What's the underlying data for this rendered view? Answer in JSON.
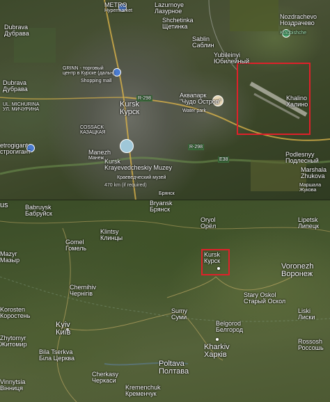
{
  "top": {
    "places": [
      {
        "name": "metro",
        "l1": "METRO",
        "l2": "Hypermarket"
      },
      {
        "name": "lazurnoye",
        "l1": "Lazurnoye",
        "l2": "Лазурное"
      },
      {
        "name": "dubrava",
        "l1": "Dubrava",
        "l2": "Дубрава"
      },
      {
        "name": "shchetinka",
        "l1": "Shchetinka",
        "l2": "Щетинка"
      },
      {
        "name": "sablin",
        "l1": "Sablin",
        "l2": "Саблин"
      },
      {
        "name": "nozdrachevo",
        "l1": "Nozdrachevo",
        "l2": "Ноздрачево"
      },
      {
        "name": "kladbishche",
        "l1": "Kladbishche",
        "l2": ""
      },
      {
        "name": "yubileynyi",
        "l1": "Yubileinyi",
        "l2": "Юбилейный"
      },
      {
        "name": "grinn",
        "l1": "GRINN - торговый",
        "l2": "центр в Курске (дальн)"
      },
      {
        "name": "shopping-mall",
        "l1": "Shopping mall",
        "l2": ""
      },
      {
        "name": "dubrava2",
        "l1": "Dubrava",
        "l2": "Дубрава"
      },
      {
        "name": "ul-michurina",
        "l1": "UL. MICHURINA",
        "l2": "УЛ. МИЧУРИНА"
      },
      {
        "name": "kursk-city",
        "l1": "Kursk",
        "l2": "Курск"
      },
      {
        "name": "akvapark",
        "l1": "Аквапарк",
        "l2": "\"Чудо Остров\""
      },
      {
        "name": "water-park",
        "l1": "Water park",
        "l2": ""
      },
      {
        "name": "khalino",
        "l1": "Khalino",
        "l2": "Халино"
      },
      {
        "name": "cossack",
        "l1": "COSSACK",
        "l2": "КАЗАЦКАЯ"
      },
      {
        "name": "etrogigant",
        "l1": "etrogigant",
        "l2": "строгигант"
      },
      {
        "name": "manezh",
        "l1": "Manezh",
        "l2": "Манеж"
      },
      {
        "name": "kursk-museum",
        "l1": "Kursk",
        "l2": "Krayevedcheskiy Muzey"
      },
      {
        "name": "museum-ru",
        "l1": "Краеведческий музей",
        "l2": ""
      },
      {
        "name": "podlesnyy",
        "l1": "Podlesnyy",
        "l2": "Подлесный"
      },
      {
        "name": "marshala",
        "l1": "Marshala",
        "l2": "Zhukova"
      },
      {
        "name": "marshala-ru",
        "l1": "Маршала",
        "l2": "Жукова"
      },
      {
        "name": "distance",
        "l1": "470 km (if required)",
        "l2": ""
      },
      {
        "name": "bryansk-top",
        "l1": "Брянск",
        "l2": ""
      }
    ],
    "roads": [
      "R-298",
      "R-298",
      "E38"
    ]
  },
  "bottom": {
    "places": [
      {
        "name": "babruysk",
        "l1": "Babruysk",
        "l2": "Бабруйск"
      },
      {
        "name": "bryansk",
        "l1": "Bryansk",
        "l2": "Брянск"
      },
      {
        "name": "orel",
        "l1": "Oryol",
        "l2": "Орёл"
      },
      {
        "name": "lipetsk",
        "l1": "Lipetsk",
        "l2": "Липецк"
      },
      {
        "name": "us",
        "l1": "us",
        "l2": ""
      },
      {
        "name": "klintsy",
        "l1": "Klintsy",
        "l2": "Клинцы"
      },
      {
        "name": "gomel",
        "l1": "Gomel",
        "l2": "Гомель"
      },
      {
        "name": "mazyr",
        "l1": "Mazyr",
        "l2": "Мазыр"
      },
      {
        "name": "kursk",
        "l1": "Kursk",
        "l2": "Курск"
      },
      {
        "name": "voronezh",
        "l1": "Voronezh",
        "l2": "Воронеж"
      },
      {
        "name": "chernihiv",
        "l1": "Chernihiv",
        "l2": "Чернігів"
      },
      {
        "name": "stary-oskol",
        "l1": "Stary Oskol",
        "l2": "Старый Оскол"
      },
      {
        "name": "korosten",
        "l1": "Korosten",
        "l2": "Коростень"
      },
      {
        "name": "sumy",
        "l1": "Sumy",
        "l2": "Суми"
      },
      {
        "name": "liski",
        "l1": "Liski",
        "l2": "Лиски"
      },
      {
        "name": "belgorod",
        "l1": "Belgorod",
        "l2": "Белгород"
      },
      {
        "name": "kyiv",
        "l1": "Kyiv",
        "l2": "Київ"
      },
      {
        "name": "kharkiv",
        "l1": "Kharkiv",
        "l2": "Харків"
      },
      {
        "name": "zhytomyr",
        "l1": "Zhytomyr",
        "l2": "Житомир"
      },
      {
        "name": "rossosh",
        "l1": "Rossosh",
        "l2": "Россошь"
      },
      {
        "name": "bila-tserkva",
        "l1": "Bila Tserkva",
        "l2": "Біла Церква"
      },
      {
        "name": "cherkasy",
        "l1": "Cherkasy",
        "l2": "Черкаси"
      },
      {
        "name": "poltava",
        "l1": "Poltava",
        "l2": "Полтава"
      },
      {
        "name": "vinnytsia",
        "l1": "Vinnytsia",
        "l2": "Вінниця"
      },
      {
        "name": "kremenchuk",
        "l1": "Kremenchuk",
        "l2": "Кременчук"
      }
    ]
  },
  "colors": {
    "highlight": "#e0202a",
    "poi": "#4a7bd0",
    "road": "#c6a24a"
  }
}
